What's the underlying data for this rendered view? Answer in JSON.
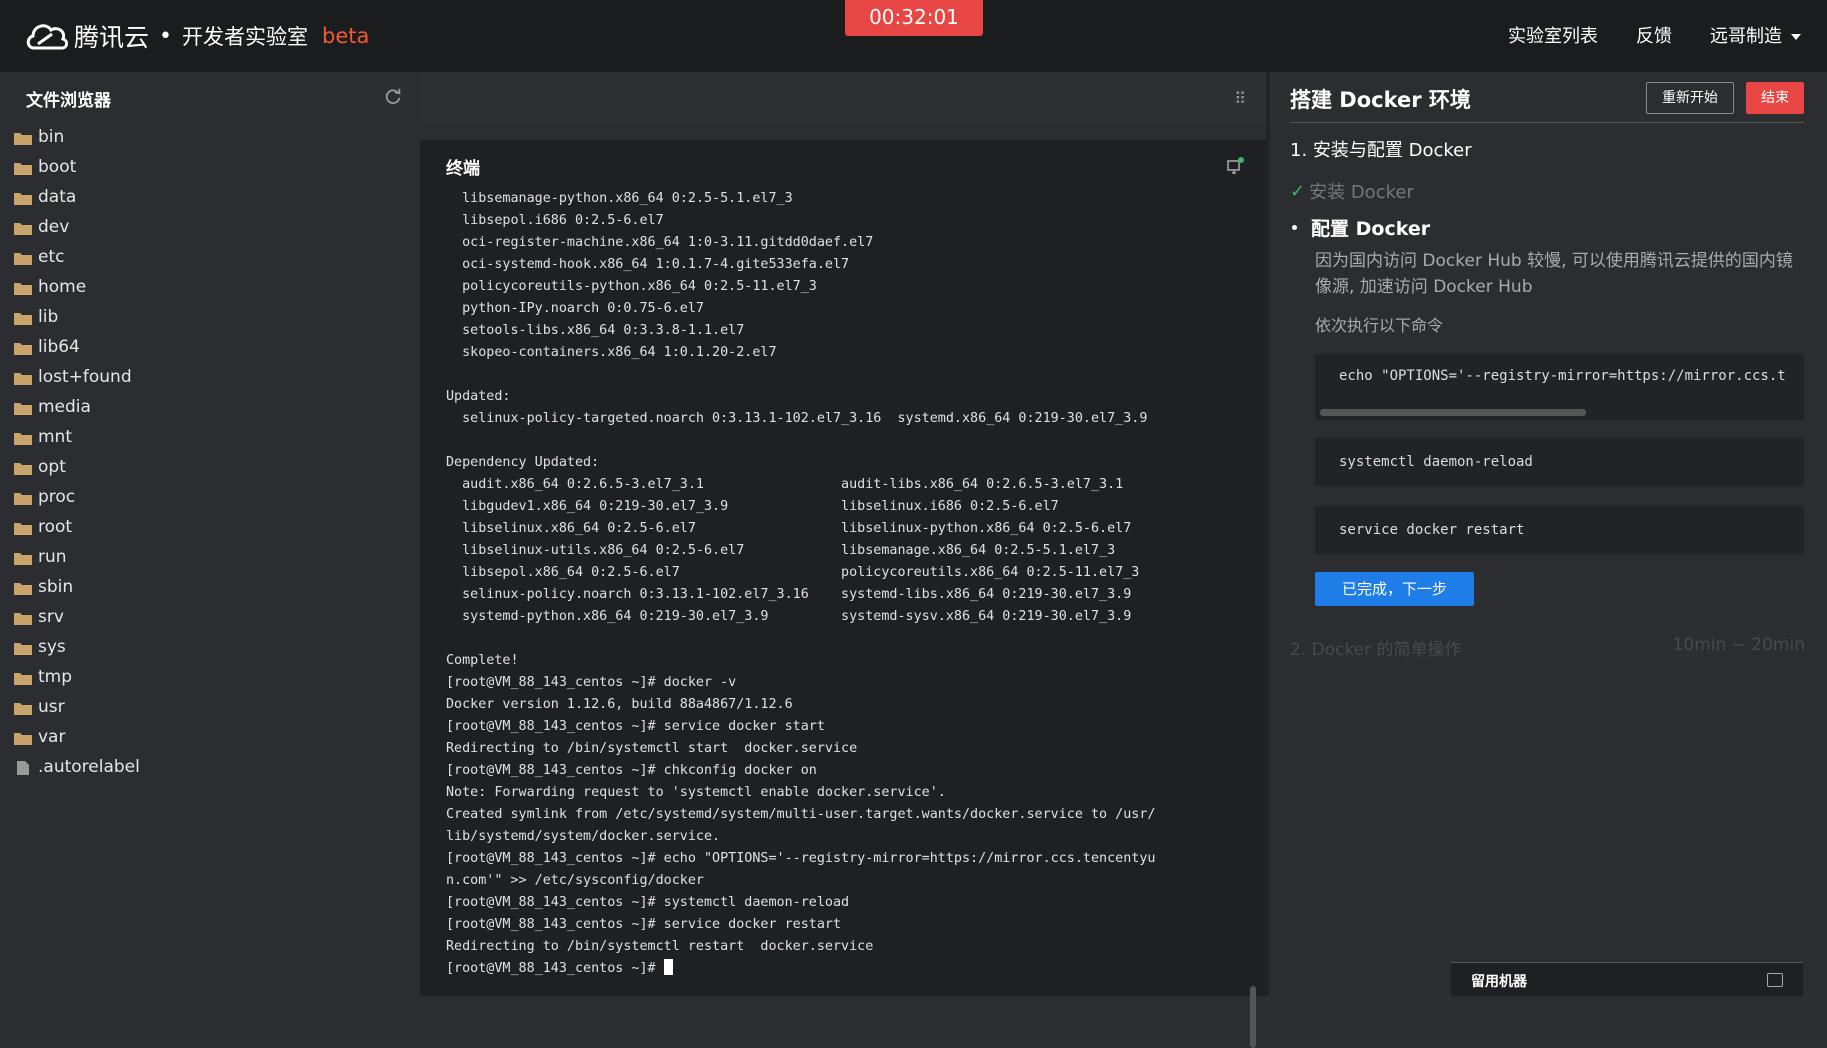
{
  "header": {
    "brand": "腾讯云",
    "separator": "•",
    "lab_title": "开发者实验室",
    "beta": "beta",
    "timer": "00:32:01",
    "nav": [
      "实验室列表",
      "反馈",
      "远哥制造"
    ]
  },
  "file_browser": {
    "title": "文件浏览器",
    "items": [
      {
        "name": "bin",
        "type": "folder"
      },
      {
        "name": "boot",
        "type": "folder"
      },
      {
        "name": "data",
        "type": "folder"
      },
      {
        "name": "dev",
        "type": "folder"
      },
      {
        "name": "etc",
        "type": "folder"
      },
      {
        "name": "home",
        "type": "folder"
      },
      {
        "name": "lib",
        "type": "folder"
      },
      {
        "name": "lib64",
        "type": "folder"
      },
      {
        "name": "lost+found",
        "type": "folder"
      },
      {
        "name": "media",
        "type": "folder"
      },
      {
        "name": "mnt",
        "type": "folder"
      },
      {
        "name": "opt",
        "type": "folder"
      },
      {
        "name": "proc",
        "type": "folder"
      },
      {
        "name": "root",
        "type": "folder"
      },
      {
        "name": "run",
        "type": "folder"
      },
      {
        "name": "sbin",
        "type": "folder"
      },
      {
        "name": "srv",
        "type": "folder"
      },
      {
        "name": "sys",
        "type": "folder"
      },
      {
        "name": "tmp",
        "type": "folder"
      },
      {
        "name": "usr",
        "type": "folder"
      },
      {
        "name": "var",
        "type": "folder"
      },
      {
        "name": ".autorelabel",
        "type": "file"
      }
    ]
  },
  "terminal": {
    "title": "终端",
    "lines": [
      "  libsemanage-python.x86_64 0:2.5-5.1.el7_3",
      "  libsepol.i686 0:2.5-6.el7",
      "  oci-register-machine.x86_64 1:0-3.11.gitdd0daef.el7",
      "  oci-systemd-hook.x86_64 1:0.1.7-4.gite533efa.el7",
      "  policycoreutils-python.x86_64 0:2.5-11.el7_3",
      "  python-IPy.noarch 0:0.75-6.el7",
      "  setools-libs.x86_64 0:3.3.8-1.1.el7",
      "  skopeo-containers.x86_64 1:0.1.20-2.el7",
      "",
      "Updated:",
      "  selinux-policy-targeted.noarch 0:3.13.1-102.el7_3.16  systemd.x86_64 0:219-30.el7_3.9",
      "",
      "Dependency Updated:",
      "  audit.x86_64 0:2.6.5-3.el7_3.1                 audit-libs.x86_64 0:2.6.5-3.el7_3.1",
      "  libgudev1.x86_64 0:219-30.el7_3.9              libselinux.i686 0:2.5-6.el7",
      "  libselinux.x86_64 0:2.5-6.el7                  libselinux-python.x86_64 0:2.5-6.el7",
      "  libselinux-utils.x86_64 0:2.5-6.el7            libsemanage.x86_64 0:2.5-5.1.el7_3",
      "  libsepol.x86_64 0:2.5-6.el7                    policycoreutils.x86_64 0:2.5-11.el7_3",
      "  selinux-policy.noarch 0:3.13.1-102.el7_3.16    systemd-libs.x86_64 0:219-30.el7_3.9",
      "  systemd-python.x86_64 0:219-30.el7_3.9         systemd-sysv.x86_64 0:219-30.el7_3.9",
      "",
      "Complete!",
      "[root@VM_88_143_centos ~]# docker -v",
      "Docker version 1.12.6, build 88a4867/1.12.6",
      "[root@VM_88_143_centos ~]# service docker start",
      "Redirecting to /bin/systemctl start  docker.service",
      "[root@VM_88_143_centos ~]# chkconfig docker on",
      "Note: Forwarding request to 'systemctl enable docker.service'.",
      "Created symlink from /etc/systemd/system/multi-user.target.wants/docker.service to /usr/",
      "lib/systemd/system/docker.service.",
      "[root@VM_88_143_centos ~]# echo \"OPTIONS='--registry-mirror=https://mirror.ccs.tencentyu",
      "n.com'\" >> /etc/sysconfig/docker",
      "[root@VM_88_143_centos ~]# systemctl daemon-reload",
      "[root@VM_88_143_centos ~]# service docker restart",
      "Redirecting to /bin/systemctl restart  docker.service",
      "[root@VM_88_143_centos ~]# "
    ]
  },
  "tutorial": {
    "title": "搭建 Docker 环境",
    "restart_label": "重新开始",
    "end_label": "结束",
    "section1": "1. 安装与配置 Docker",
    "step_done": "安装 Docker",
    "step_current": "配置 Docker",
    "description": "因为国内访问 Docker Hub 较慢, 可以使用腾讯云提供的国内镜像源, 加速访问 Docker Hub",
    "instruction": "依次执行以下命令",
    "commands": [
      "echo \"OPTIONS='--registry-mirror=https://mirror.ccs.t",
      "systemctl daemon-reload",
      "service docker restart"
    ],
    "next_label": "已完成，下一步",
    "section2": "2. Docker 的简单操作",
    "section2_time": "10min ~ 20min"
  },
  "keep_machine": {
    "label": "留用机器"
  },
  "colors": {
    "accent_red": "#e84545",
    "accent_blue": "#1e7de6",
    "beta_orange": "#f05a32",
    "check_green": "#3cb371"
  }
}
